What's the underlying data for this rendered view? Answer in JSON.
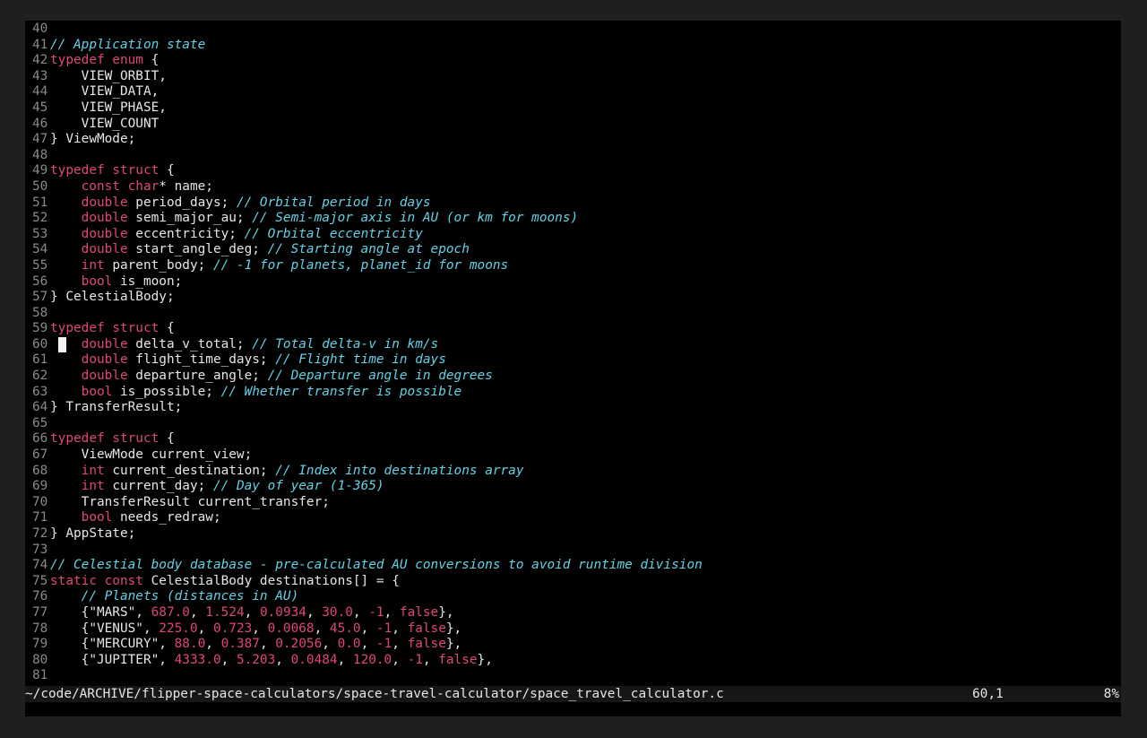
{
  "editor": {
    "colors": {
      "background": "#000000",
      "keyword": "#e0457b",
      "comment": "#62d1e6",
      "text": "#e6e6e6",
      "line_number": "#8a8a8a"
    },
    "cursor_line": 60,
    "lines": [
      {
        "n": "40",
        "segs": []
      },
      {
        "n": "41",
        "segs": [
          {
            "t": "// Application state",
            "c": "cm"
          }
        ]
      },
      {
        "n": "42",
        "segs": [
          {
            "t": "typedef enum",
            "c": "kw"
          },
          {
            "t": " {",
            "c": ""
          }
        ]
      },
      {
        "n": "43",
        "segs": [
          {
            "t": "    VIEW_ORBIT,",
            "c": ""
          }
        ]
      },
      {
        "n": "44",
        "segs": [
          {
            "t": "    VIEW_DATA,",
            "c": ""
          }
        ]
      },
      {
        "n": "45",
        "segs": [
          {
            "t": "    VIEW_PHASE,",
            "c": ""
          }
        ]
      },
      {
        "n": "46",
        "segs": [
          {
            "t": "    VIEW_COUNT",
            "c": ""
          }
        ]
      },
      {
        "n": "47",
        "segs": [
          {
            "t": "} ViewMode;",
            "c": ""
          }
        ]
      },
      {
        "n": "48",
        "segs": []
      },
      {
        "n": "49",
        "segs": [
          {
            "t": "typedef struct",
            "c": "kw"
          },
          {
            "t": " {",
            "c": ""
          }
        ]
      },
      {
        "n": "50",
        "segs": [
          {
            "t": "    ",
            "c": ""
          },
          {
            "t": "const char",
            "c": "kw"
          },
          {
            "t": "* name;",
            "c": ""
          }
        ]
      },
      {
        "n": "51",
        "segs": [
          {
            "t": "    ",
            "c": ""
          },
          {
            "t": "double",
            "c": "kw"
          },
          {
            "t": " period_days; ",
            "c": ""
          },
          {
            "t": "// Orbital period in days",
            "c": "cm"
          }
        ]
      },
      {
        "n": "52",
        "segs": [
          {
            "t": "    ",
            "c": ""
          },
          {
            "t": "double",
            "c": "kw"
          },
          {
            "t": " semi_major_au; ",
            "c": ""
          },
          {
            "t": "// Semi-major axis in AU (or km for moons)",
            "c": "cm"
          }
        ]
      },
      {
        "n": "53",
        "segs": [
          {
            "t": "    ",
            "c": ""
          },
          {
            "t": "double",
            "c": "kw"
          },
          {
            "t": " eccentricity; ",
            "c": ""
          },
          {
            "t": "// Orbital eccentricity",
            "c": "cm"
          }
        ]
      },
      {
        "n": "54",
        "segs": [
          {
            "t": "    ",
            "c": ""
          },
          {
            "t": "double",
            "c": "kw"
          },
          {
            "t": " start_angle_deg; ",
            "c": ""
          },
          {
            "t": "// Starting angle at epoch",
            "c": "cm"
          }
        ]
      },
      {
        "n": "55",
        "segs": [
          {
            "t": "    ",
            "c": ""
          },
          {
            "t": "int",
            "c": "kw"
          },
          {
            "t": " parent_body; ",
            "c": ""
          },
          {
            "t": "// -1 for planets, planet_id for moons",
            "c": "cm"
          }
        ]
      },
      {
        "n": "56",
        "segs": [
          {
            "t": "    ",
            "c": ""
          },
          {
            "t": "bool",
            "c": "kw"
          },
          {
            "t": " is_moon;",
            "c": ""
          }
        ]
      },
      {
        "n": "57",
        "segs": [
          {
            "t": "} CelestialBody;",
            "c": ""
          }
        ]
      },
      {
        "n": "58",
        "segs": []
      },
      {
        "n": "59",
        "segs": [
          {
            "t": "typedef struct",
            "c": "kw"
          },
          {
            "t": " {",
            "c": ""
          }
        ]
      },
      {
        "n": "60",
        "segs": [
          {
            "t": "    ",
            "c": ""
          },
          {
            "t": "double",
            "c": "kw"
          },
          {
            "t": " delta_v_total; ",
            "c": ""
          },
          {
            "t": "// Total delta-v in km/s",
            "c": "cm"
          }
        ]
      },
      {
        "n": "61",
        "segs": [
          {
            "t": "    ",
            "c": ""
          },
          {
            "t": "double",
            "c": "kw"
          },
          {
            "t": " flight_time_days; ",
            "c": ""
          },
          {
            "t": "// Flight time in days",
            "c": "cm"
          }
        ]
      },
      {
        "n": "62",
        "segs": [
          {
            "t": "    ",
            "c": ""
          },
          {
            "t": "double",
            "c": "kw"
          },
          {
            "t": " departure_angle; ",
            "c": ""
          },
          {
            "t": "// Departure angle in degrees",
            "c": "cm"
          }
        ]
      },
      {
        "n": "63",
        "segs": [
          {
            "t": "    ",
            "c": ""
          },
          {
            "t": "bool",
            "c": "kw"
          },
          {
            "t": " is_possible; ",
            "c": ""
          },
          {
            "t": "// Whether transfer is possible",
            "c": "cm"
          }
        ]
      },
      {
        "n": "64",
        "segs": [
          {
            "t": "} TransferResult;",
            "c": ""
          }
        ]
      },
      {
        "n": "65",
        "segs": []
      },
      {
        "n": "66",
        "segs": [
          {
            "t": "typedef struct",
            "c": "kw"
          },
          {
            "t": " {",
            "c": ""
          }
        ]
      },
      {
        "n": "67",
        "segs": [
          {
            "t": "    ViewMode current_view;",
            "c": ""
          }
        ]
      },
      {
        "n": "68",
        "segs": [
          {
            "t": "    ",
            "c": ""
          },
          {
            "t": "int",
            "c": "kw"
          },
          {
            "t": " current_destination; ",
            "c": ""
          },
          {
            "t": "// Index into destinations array",
            "c": "cm"
          }
        ]
      },
      {
        "n": "69",
        "segs": [
          {
            "t": "    ",
            "c": ""
          },
          {
            "t": "int",
            "c": "kw"
          },
          {
            "t": " current_day; ",
            "c": ""
          },
          {
            "t": "// Day of year (1-365)",
            "c": "cm"
          }
        ]
      },
      {
        "n": "70",
        "segs": [
          {
            "t": "    TransferResult current_transfer;",
            "c": ""
          }
        ]
      },
      {
        "n": "71",
        "segs": [
          {
            "t": "    ",
            "c": ""
          },
          {
            "t": "bool",
            "c": "kw"
          },
          {
            "t": " needs_redraw;",
            "c": ""
          }
        ]
      },
      {
        "n": "72",
        "segs": [
          {
            "t": "} AppState;",
            "c": ""
          }
        ]
      },
      {
        "n": "73",
        "segs": []
      },
      {
        "n": "74",
        "segs": [
          {
            "t": "// Celestial body database - pre-calculated AU conversions to avoid runtime division",
            "c": "cm"
          }
        ]
      },
      {
        "n": "75",
        "segs": [
          {
            "t": "static const",
            "c": "kw"
          },
          {
            "t": " CelestialBody destinations[] = {",
            "c": ""
          }
        ]
      },
      {
        "n": "76",
        "segs": [
          {
            "t": "    ",
            "c": ""
          },
          {
            "t": "// Planets (distances in AU)",
            "c": "cm"
          }
        ]
      },
      {
        "n": "77",
        "segs": [
          {
            "t": "    {\"MARS\", ",
            "c": ""
          },
          {
            "t": "687.0",
            "c": "num"
          },
          {
            "t": ", ",
            "c": ""
          },
          {
            "t": "1.524",
            "c": "num"
          },
          {
            "t": ", ",
            "c": ""
          },
          {
            "t": "0.0934",
            "c": "num"
          },
          {
            "t": ", ",
            "c": ""
          },
          {
            "t": "30.0",
            "c": "num"
          },
          {
            "t": ", ",
            "c": ""
          },
          {
            "t": "-1",
            "c": "num"
          },
          {
            "t": ", ",
            "c": ""
          },
          {
            "t": "false",
            "c": "kw"
          },
          {
            "t": "},",
            "c": ""
          }
        ]
      },
      {
        "n": "78",
        "segs": [
          {
            "t": "    {\"VENUS\", ",
            "c": ""
          },
          {
            "t": "225.0",
            "c": "num"
          },
          {
            "t": ", ",
            "c": ""
          },
          {
            "t": "0.723",
            "c": "num"
          },
          {
            "t": ", ",
            "c": ""
          },
          {
            "t": "0.0068",
            "c": "num"
          },
          {
            "t": ", ",
            "c": ""
          },
          {
            "t": "45.0",
            "c": "num"
          },
          {
            "t": ", ",
            "c": ""
          },
          {
            "t": "-1",
            "c": "num"
          },
          {
            "t": ", ",
            "c": ""
          },
          {
            "t": "false",
            "c": "kw"
          },
          {
            "t": "},",
            "c": ""
          }
        ]
      },
      {
        "n": "79",
        "segs": [
          {
            "t": "    {\"MERCURY\", ",
            "c": ""
          },
          {
            "t": "88.0",
            "c": "num"
          },
          {
            "t": ", ",
            "c": ""
          },
          {
            "t": "0.387",
            "c": "num"
          },
          {
            "t": ", ",
            "c": ""
          },
          {
            "t": "0.2056",
            "c": "num"
          },
          {
            "t": ", ",
            "c": ""
          },
          {
            "t": "0.0",
            "c": "num"
          },
          {
            "t": ", ",
            "c": ""
          },
          {
            "t": "-1",
            "c": "num"
          },
          {
            "t": ", ",
            "c": ""
          },
          {
            "t": "false",
            "c": "kw"
          },
          {
            "t": "},",
            "c": ""
          }
        ]
      },
      {
        "n": "80",
        "segs": [
          {
            "t": "    {\"JUPITER\", ",
            "c": ""
          },
          {
            "t": "4333.0",
            "c": "num"
          },
          {
            "t": ", ",
            "c": ""
          },
          {
            "t": "5.203",
            "c": "num"
          },
          {
            "t": ", ",
            "c": ""
          },
          {
            "t": "0.0484",
            "c": "num"
          },
          {
            "t": ", ",
            "c": ""
          },
          {
            "t": "120.0",
            "c": "num"
          },
          {
            "t": ", ",
            "c": ""
          },
          {
            "t": "-1",
            "c": "num"
          },
          {
            "t": ", ",
            "c": ""
          },
          {
            "t": "false",
            "c": "kw"
          },
          {
            "t": "},",
            "c": ""
          }
        ]
      },
      {
        "n": "81",
        "segs": []
      }
    ]
  },
  "status": {
    "file_path": "~/code/ARCHIVE/flipper-space-calculators/space-travel-calculator/space_travel_calculator.c",
    "cursor_position": "60,1",
    "scroll_percent": "8%"
  }
}
